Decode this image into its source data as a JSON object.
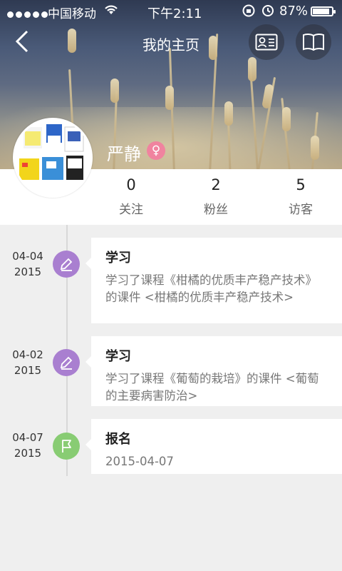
{
  "status_bar": {
    "carrier": "中国移动",
    "time": "下午2:11",
    "battery": "87%",
    "battery_level": 0.87
  },
  "nav": {
    "back_icon": "chevron-left-icon",
    "title": "我的主页",
    "card_icon": "id-card-icon",
    "book_icon": "book-icon"
  },
  "profile": {
    "name": "严静",
    "gender_symbol": "♀",
    "stats": [
      {
        "value": "0",
        "label": "关注"
      },
      {
        "value": "2",
        "label": "粉丝"
      },
      {
        "value": "5",
        "label": "访客"
      }
    ]
  },
  "timeline": [
    {
      "date": "04-04",
      "year": "2015",
      "icon": "pencil-icon",
      "title": "学习",
      "body": "学习了课程《柑橘的优质丰产稳产技术》的课件 <柑橘的优质丰产稳产技术>"
    },
    {
      "date": "04-02",
      "year": "2015",
      "icon": "pencil-icon",
      "title": "学习",
      "body": "学习了课程《葡萄的栽培》的课件 <葡萄的主要病害防治>"
    },
    {
      "date": "04-07",
      "year": "2015",
      "icon": "flag-icon",
      "title": "报名",
      "body": "2015-04-07"
    }
  ],
  "colors": {
    "study_icon": "#a97fd0",
    "signup_icon": "#88cc73",
    "gender_badge": "#f0839f"
  }
}
